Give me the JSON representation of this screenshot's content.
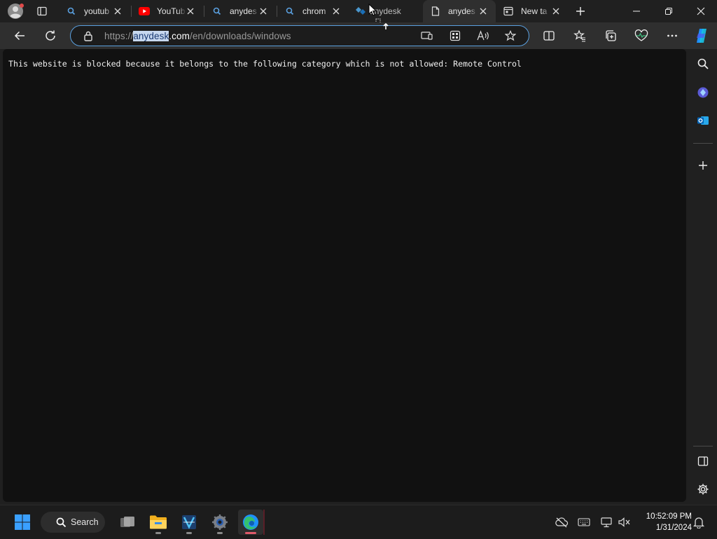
{
  "tabs": [
    {
      "title": "youtub",
      "icon": "search-icon"
    },
    {
      "title": "YouTub",
      "icon": "youtube-icon"
    },
    {
      "title": "anydes",
      "icon": "search-icon"
    },
    {
      "title": "chrom",
      "icon": "search-icon"
    },
    {
      "title": "anydes",
      "icon": "page-icon",
      "active": true
    },
    {
      "title": "New ta",
      "icon": "new-tab-icon"
    }
  ],
  "drag_ghost": {
    "label": "anydesk"
  },
  "address_bar": {
    "prefix": "https://",
    "highlighted": "anydesk",
    "domain_rest": ".com",
    "path": "/en/downloads/windows"
  },
  "page": {
    "message": "This website is blocked because it belongs to the following category which is not allowed: Remote Control"
  },
  "taskbar": {
    "search_label": "Search",
    "time": "10:52:09 PM",
    "date": "1/31/2024"
  },
  "colors": {
    "accent": "#5aa0e0",
    "page_bg": "#111111",
    "chrome_bg": "#202020",
    "toolbar_bg": "#2f2f2f",
    "edge_blue": "#1e90ff",
    "youtube_red": "#ff0000"
  }
}
